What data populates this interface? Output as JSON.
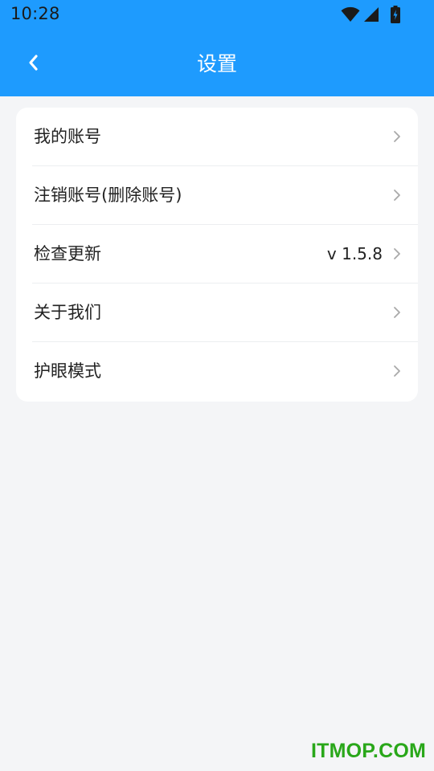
{
  "status_bar": {
    "time": "10:28",
    "icons": [
      "wifi-icon",
      "signal-icon",
      "battery-charging-icon"
    ]
  },
  "app_bar": {
    "title": "设置",
    "back_icon": "chevron-left-icon"
  },
  "settings": {
    "items": [
      {
        "label": "我的账号",
        "value": ""
      },
      {
        "label": "注销账号(删除账号)",
        "value": ""
      },
      {
        "label": "检查更新",
        "value": "v 1.5.8"
      },
      {
        "label": "关于我们",
        "value": ""
      },
      {
        "label": "护眼模式",
        "value": ""
      }
    ]
  },
  "watermark": "ITMOP.COM",
  "colors": {
    "header": "#1e9bfe",
    "background": "#f4f5f7",
    "card": "#ffffff",
    "watermark": "#29a71a"
  }
}
